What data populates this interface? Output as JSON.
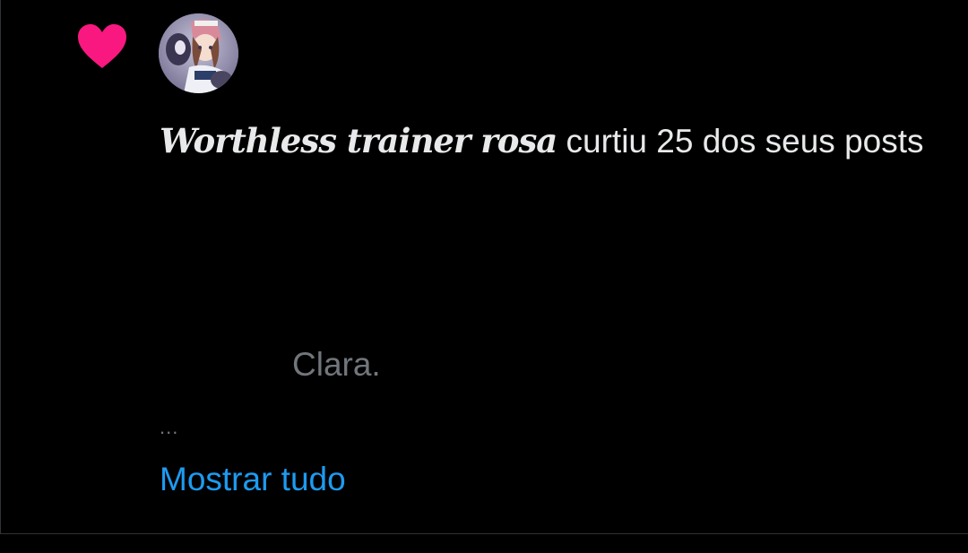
{
  "notification": {
    "type_icon": "heart-icon",
    "user_name": "Worthless trainer rosa",
    "action_text": " curtiu 25 dos seus posts",
    "post_preview": "Clara.",
    "ellipsis": "...",
    "show_all_label": "Mostrar tudo"
  },
  "colors": {
    "background": "#000000",
    "heart": "#f91880",
    "primary_text": "#e7e9ea",
    "secondary_text": "#71767b",
    "link": "#1d9bf0",
    "divider": "#2f3336"
  }
}
